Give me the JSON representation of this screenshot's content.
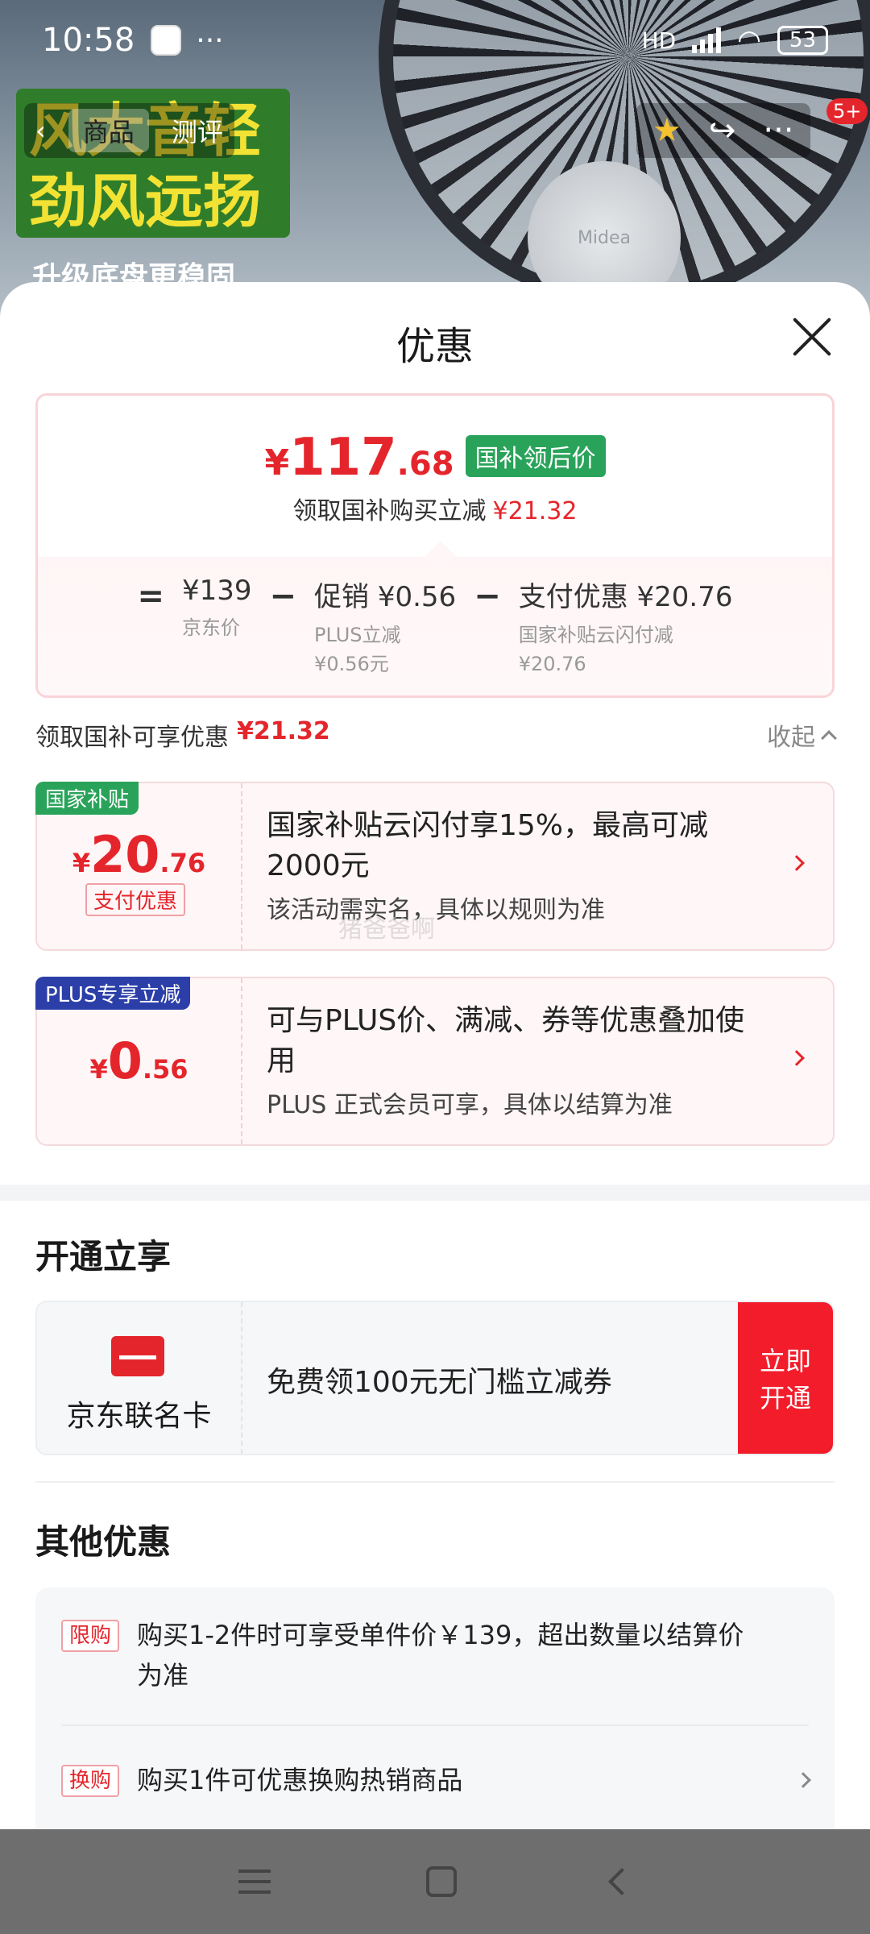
{
  "status_bar": {
    "time": "10:58",
    "dots": "···",
    "network": "HD",
    "battery": "53"
  },
  "background": {
    "logo_text": "Midea",
    "promo_lines": [
      "风大音轻",
      "劲风远扬"
    ],
    "promo_sub": "升级底盘更稳固",
    "nav_tabs": [
      "商品",
      "测评"
    ],
    "badge": "5+"
  },
  "sheet": {
    "title": "优惠",
    "price": {
      "yen": "¥",
      "int": "117",
      "dec": ".68",
      "tag": "国补领后价"
    },
    "subline": {
      "label": "领取国补购买立减",
      "value": "¥21.32"
    },
    "formula": [
      {
        "op": "=",
        "value": "¥139",
        "label": "京东价",
        "label2": ""
      },
      {
        "op": "−",
        "value": "促销 ¥0.56",
        "label": "PLUS立减",
        "label2": "¥0.56元"
      },
      {
        "op": "−",
        "value": "支付优惠 ¥20.76",
        "label": "国家补贴云闪付减",
        "label2": "¥20.76"
      }
    ],
    "section": {
      "label": "领取国补可享优惠",
      "value": "¥21.32",
      "collapse": "收起"
    },
    "offers": [
      {
        "tag": "国家补贴",
        "tag_color": "#2aa35a",
        "yen": "¥",
        "int": "20",
        "dec": ".76",
        "subtag": "支付优惠",
        "title": "国家补贴云闪付享15%，最高可减2000元",
        "desc": "该活动需实名，具体以规则为准"
      },
      {
        "tag": "PLUS专享立减",
        "tag_color": "#2c3fa8",
        "yen": "¥",
        "int": "0",
        "dec": ".56",
        "subtag": "",
        "title": "可与PLUS价、满减、券等优惠叠加使用",
        "desc": "PLUS 正式会员可享，具体以结算为准"
      }
    ],
    "watermark": "猪爸爸啊",
    "open_section": {
      "title": "开通立享",
      "card_name": "京东联名卡",
      "text": "免费领100元无门槛立减券",
      "button": "立即开通"
    },
    "other_section": {
      "title": "其他优惠",
      "rows": [
        {
          "tag": "限购",
          "text": "购买1-2件时可享受单件价￥139，超出数量以结算价为准"
        },
        {
          "tag": "换购",
          "text": "购买1件可优惠换购热销商品"
        }
      ]
    }
  }
}
